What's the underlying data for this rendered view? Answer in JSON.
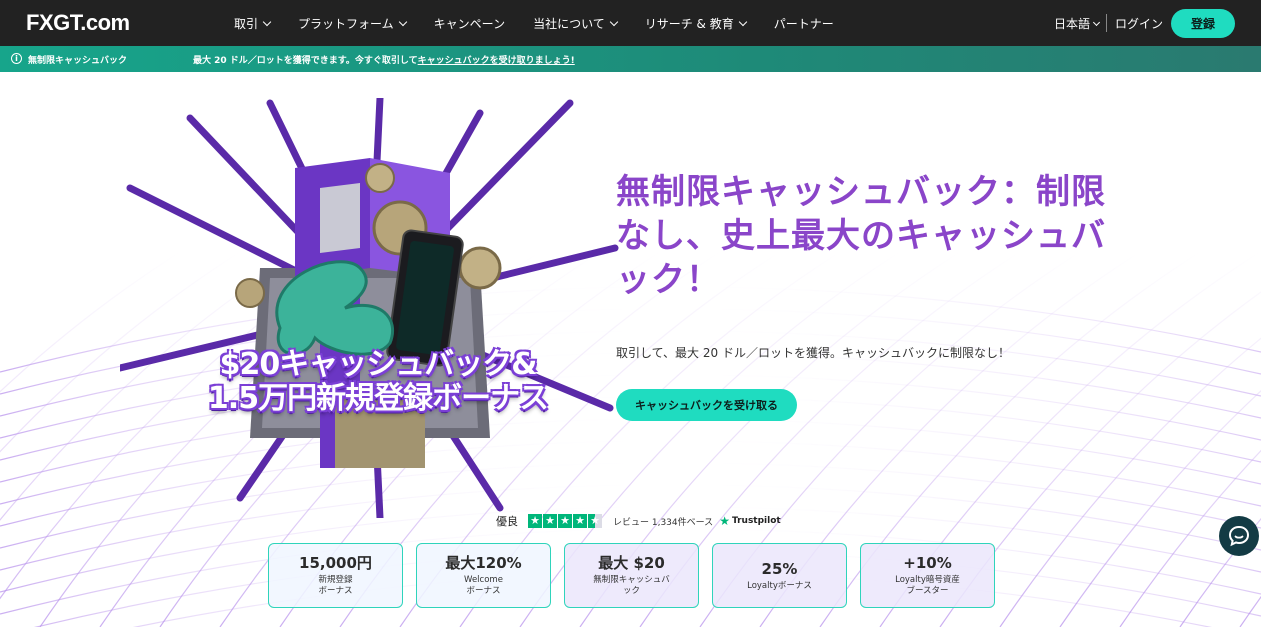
{
  "header": {
    "logo_main": "FXGT",
    "logo_suffix": ".com",
    "nav": [
      {
        "label": "取引",
        "has_dropdown": true
      },
      {
        "label": "プラットフォーム",
        "has_dropdown": true
      },
      {
        "label": "キャンペーン",
        "has_dropdown": false
      },
      {
        "label": "当社について",
        "has_dropdown": true
      },
      {
        "label": "リサーチ & 教育",
        "has_dropdown": true
      },
      {
        "label": "パートナー",
        "has_dropdown": false
      }
    ],
    "language": "日本語",
    "login": "ログイン",
    "signup": "登録"
  },
  "promo_bar": {
    "title": "無制限キャッシュバック",
    "text": "最大 20 ドル／ロットを獲得できます。今すぐ取引して",
    "link": "キャッシュバックを受け取りましょう!"
  },
  "hero": {
    "art_line1": "$20キャッシュバック&",
    "art_line2": "1.5万円新規登録ボーナス",
    "headline": "無制限キャッシュバック：制限なし、史上最大のキャッシュバック！",
    "subtext": "取引して、最大 20 ドル／ロットを獲得。キャッシュバックに制限なし！",
    "cta": "キャッシュバックを受け取る"
  },
  "trustpilot": {
    "rating_word": "優良",
    "stars": 4.5,
    "reviews": "レビュー 1,334件ベース",
    "brand": "Trustpilot"
  },
  "cards": [
    {
      "amount": "15,000円",
      "label": "新規登録\nボーナス"
    },
    {
      "amount": "最大120%",
      "label": "Welcome\nボーナス"
    },
    {
      "amount": "最大 $20",
      "label": "無制限キャッシュバ\nック"
    },
    {
      "amount": "25%",
      "label": "Loyaltyボーナス"
    },
    {
      "amount": "+10%",
      "label": "Loyalty暗号資産\nブースター"
    }
  ],
  "colors": {
    "accent": "#1fdcc0",
    "headline": "#8a45c9",
    "nav_bg": "#222222",
    "trustpilot_green": "#00b67a"
  }
}
